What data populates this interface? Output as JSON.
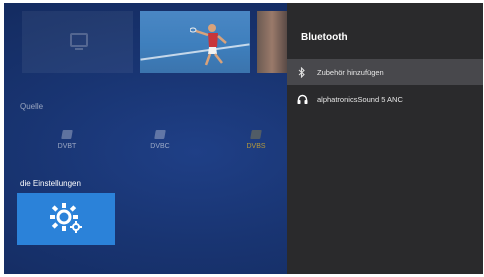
{
  "source": {
    "heading": "Quelle",
    "items": [
      {
        "label": "DVBT"
      },
      {
        "label": "DVBC"
      },
      {
        "label": "DVBS"
      }
    ]
  },
  "settings": {
    "heading": "die Einstellungen"
  },
  "bluetooth": {
    "title": "Bluetooth",
    "items": [
      {
        "label": "Zubehör hinzufügen",
        "icon": "bluetooth-icon",
        "selected": true
      },
      {
        "label": "alphatronicsSound 5 ANC",
        "icon": "headphones-icon",
        "selected": false
      }
    ]
  },
  "colors": {
    "background": "#193573",
    "panel": "#2a2a2c",
    "panel_selected": "#48484c",
    "settings_tile": "#2b82d9",
    "dvbs_accent": "#b59a3a"
  }
}
